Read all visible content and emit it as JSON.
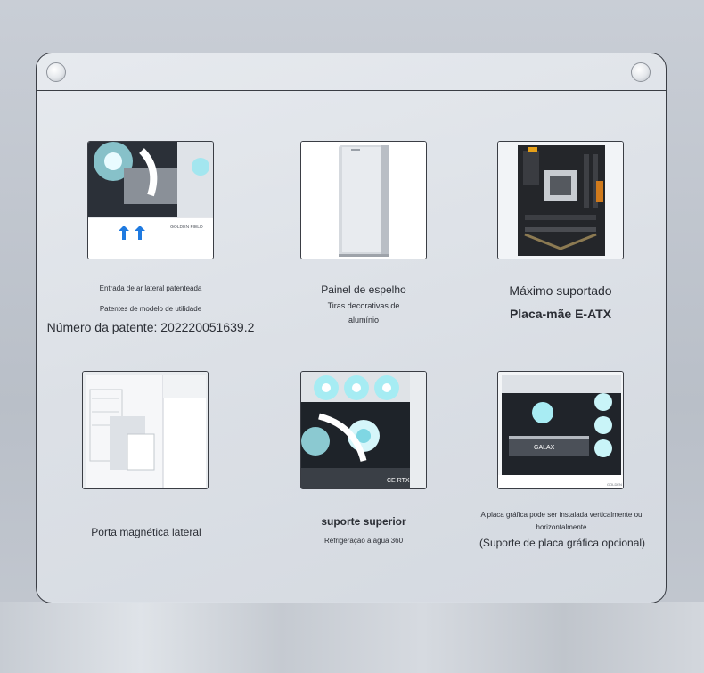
{
  "items": [
    {
      "lines": [
        "Entrada de ar lateral patenteada",
        "Patentes de modelo de utilidade",
        "Número da patente: 202220051639.2"
      ],
      "thumb_text": "GOLDEN FIELD",
      "icon": "arrow-up-icon"
    },
    {
      "lines": [
        "Painel de espelho",
        "Tiras decorativas de",
        "alumínio"
      ]
    },
    {
      "lines": [
        "Máximo suportado",
        "Placa-mãe E-ATX"
      ]
    },
    {
      "lines": [
        "Porta magnética lateral"
      ]
    },
    {
      "lines": [
        "suporte superior",
        "Refrigeração a água 360"
      ],
      "thumb_text": "CE RTX"
    },
    {
      "lines": [
        "A placa gráfica pode ser instalada verticalmente ou",
        "horizontalmente",
        "(Suporte de placa gráfica opcional)"
      ],
      "thumb_text": "GALAX",
      "thumb_text2": "GOLDEN"
    }
  ]
}
